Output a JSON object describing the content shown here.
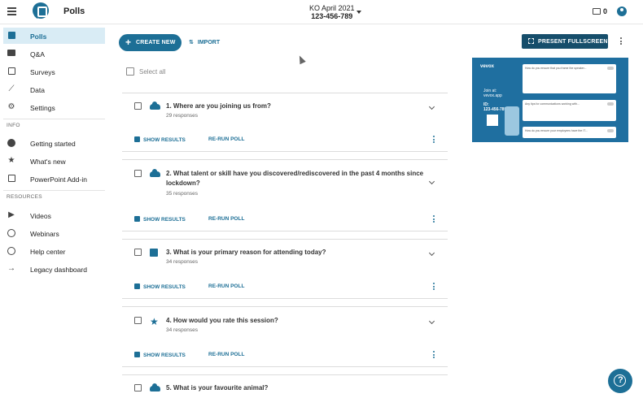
{
  "header": {
    "app_title": "Polls",
    "event_name": "KO April 2021",
    "event_code": "123-456-789",
    "device_count": "0"
  },
  "sidebar": {
    "main_items": [
      {
        "label": "Polls",
        "icon": "polls-icon",
        "active": true
      },
      {
        "label": "Q&A",
        "icon": "chat-icon"
      },
      {
        "label": "Surveys",
        "icon": "survey-icon"
      },
      {
        "label": "Data",
        "icon": "trend-icon"
      },
      {
        "label": "Settings",
        "icon": "gear-icon"
      }
    ],
    "info_label": "INFO",
    "info_items": [
      {
        "label": "Getting started",
        "icon": "help-circle-icon"
      },
      {
        "label": "What's new",
        "icon": "star-icon"
      },
      {
        "label": "PowerPoint Add-in",
        "icon": "powerpoint-icon"
      }
    ],
    "resources_label": "RESOURCES",
    "resource_items": [
      {
        "label": "Videos",
        "icon": "video-icon"
      },
      {
        "label": "Webinars",
        "icon": "clock-icon"
      },
      {
        "label": "Help center",
        "icon": "help-circle-icon"
      },
      {
        "label": "Legacy dashboard",
        "icon": "arrow-right-icon"
      }
    ]
  },
  "toolbar": {
    "create_label": "CREATE NEW",
    "import_label": "IMPORT",
    "fullscreen_label": "PRESENT FULLSCREEN",
    "select_all_label": "Select all"
  },
  "polls": [
    {
      "number": "1.",
      "question": "Where are you joining us from?",
      "responses": "29 responses",
      "type": "word-cloud"
    },
    {
      "number": "2.",
      "question": "What talent or skill have you discovered/rediscovered in the past 4 months since lockdown?",
      "responses": "35 responses",
      "type": "word-cloud"
    },
    {
      "number": "3.",
      "question": "What is your primary reason for attending today?",
      "responses": "34 responses",
      "type": "multiple-choice"
    },
    {
      "number": "4.",
      "question": "How would you rate this session?",
      "responses": "34 responses",
      "type": "rating"
    },
    {
      "number": "5.",
      "question": "What is your favourite animal?",
      "responses": "",
      "type": "word-cloud"
    }
  ],
  "poll_actions": {
    "show_results": "SHOW RESULTS",
    "rerun_poll": "RE-RUN POLL"
  },
  "preview": {
    "brand": "vevox",
    "join_line1": "Join at:",
    "join_line2": "vevox.app",
    "id_line1": "ID:",
    "id_line2": "123-456-789",
    "cards": [
      "How do you ensure that you frame the speaker...",
      "Any tips for communications working with...",
      "How do you ensure your employees have the IT..."
    ]
  },
  "colors": {
    "brand": "#1d6f96",
    "active_bg": "#d9ecf5",
    "fullscreen_bg": "#164e6b"
  }
}
